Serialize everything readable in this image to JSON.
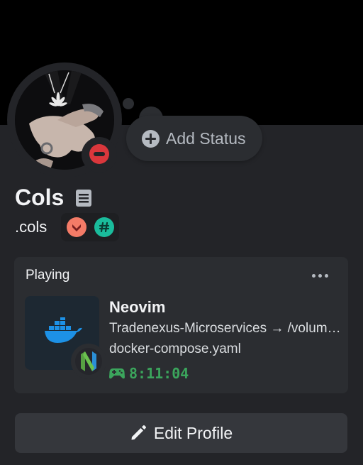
{
  "profile": {
    "display_name": "Cols",
    "username": ".cols",
    "status": "dnd",
    "add_status_label": "Add Status",
    "badges": [
      {
        "name": "hypesquad-badge",
        "color": "#f47b67"
      },
      {
        "name": "hashtag-badge",
        "color": "#1abc9c"
      }
    ]
  },
  "activity": {
    "heading": "Playing",
    "title": "Neovim",
    "details": "Tradenexus-Microservices → /volumes/docker-compose",
    "state": "docker-compose.yaml",
    "elapsed": "8:11:04"
  },
  "actions": {
    "edit_profile_label": "Edit Profile"
  },
  "colors": {
    "banner": "#000000",
    "card": "#232428",
    "dnd": "#da373c",
    "elapsed_green": "#3ba55c",
    "docker_blue": "#1d91e6",
    "neovim_green": "#57a143",
    "neovim_blue": "#2b8fd6"
  }
}
